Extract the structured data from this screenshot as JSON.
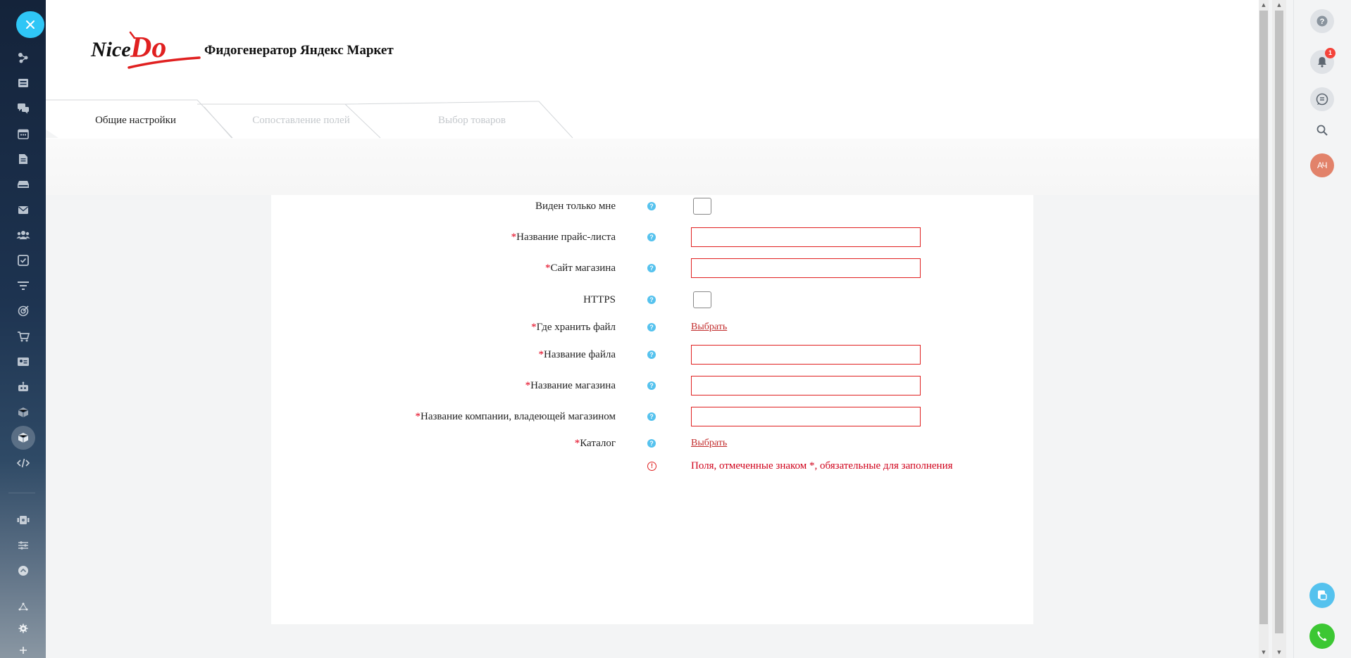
{
  "app": {
    "title": "Фидогенератор Яндекс Маркет",
    "logo_text": "Nice Do"
  },
  "tabs": [
    {
      "label": "Общие настройки",
      "active": true
    },
    {
      "label": "Сопоставление полей",
      "active": false
    },
    {
      "label": "Выбор товаров",
      "active": false
    }
  ],
  "form": {
    "rows": [
      {
        "label": "Виден только мне",
        "required": false,
        "control": "checkbox"
      },
      {
        "label": "Название прайс-листа",
        "required": true,
        "control": "input",
        "value": ""
      },
      {
        "label": "Сайт магазина",
        "required": true,
        "control": "input",
        "value": ""
      },
      {
        "label": "HTTPS",
        "required": false,
        "control": "checkbox"
      },
      {
        "label": "Где хранить файл",
        "required": true,
        "control": "link",
        "link_text": "Выбрать"
      },
      {
        "label": "Название файла",
        "required": true,
        "control": "input",
        "value": ""
      },
      {
        "label": "Название магазина",
        "required": true,
        "control": "input",
        "value": ""
      },
      {
        "label": "Название компании, владеющей магазином",
        "required": true,
        "control": "input",
        "value": ""
      },
      {
        "label": "Каталог",
        "required": true,
        "control": "link",
        "link_text": "Выбрать"
      }
    ],
    "required_mark": "*",
    "help_glyph": "?",
    "warning_glyph": "!",
    "required_note": "Поля, отмеченные знаком *, обязательные для заполнения"
  },
  "right_panel": {
    "help_glyph": "?",
    "notifications_count": "1",
    "avatar_initials": "АЧ"
  },
  "sidebar_icons": [
    "sitemap-icon",
    "news-icon",
    "chat-icon",
    "calendar-icon",
    "document-icon",
    "drive-icon",
    "mail-icon",
    "group-icon",
    "tasks-icon",
    "filter-icon",
    "target-icon",
    "cart-icon",
    "contact-card-icon",
    "robot-icon",
    "box-icon",
    "box-active-icon",
    "code-icon",
    "settings-row-icon",
    "sliders-icon",
    "arrow-up-circle-icon",
    "triangle-icon",
    "gear-icon",
    "plus-icon"
  ],
  "colors": {
    "accent": "#2fc6f6",
    "required": "#e3001b",
    "link": "#c22d2d",
    "help": "#55c2ee",
    "avatar": "#e2826a",
    "call": "#3cc733"
  }
}
